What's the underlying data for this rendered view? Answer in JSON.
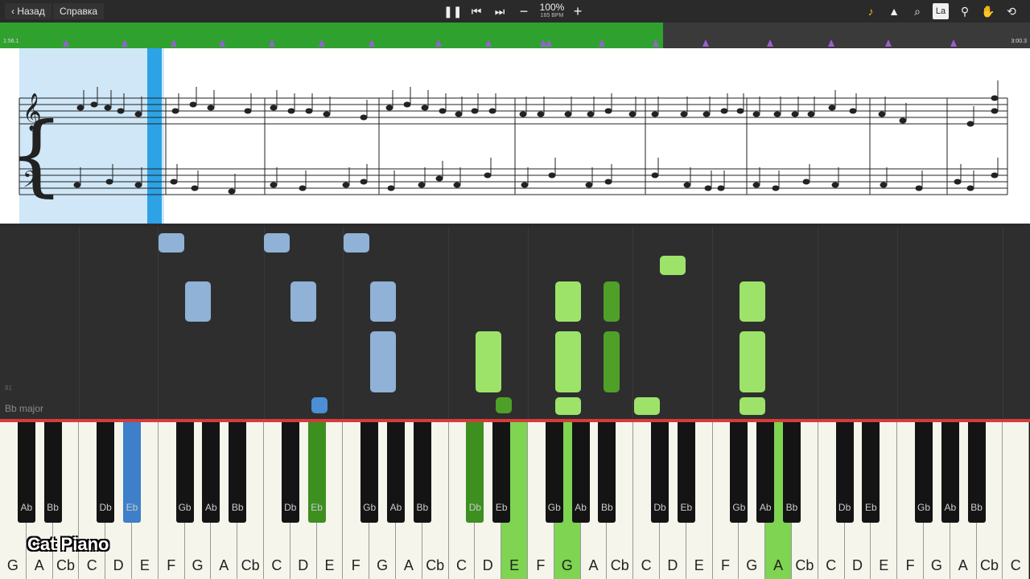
{
  "toolbar": {
    "back_label": "Назад",
    "help_label": "Справка",
    "tempo_percent": "100%",
    "tempo_bpm": "165 BPM",
    "label_button": "La"
  },
  "timeline": {
    "start_time": "1:56.1",
    "end_time": "3:00.3",
    "progress": 0.644
  },
  "roll": {
    "key_signature": "Bb major",
    "bar_number": "81"
  },
  "keyboard": {
    "white_keys": [
      "G",
      "A",
      "Cb",
      "C",
      "D",
      "E",
      "F",
      "G",
      "A",
      "Cb",
      "C",
      "D",
      "E",
      "F",
      "G",
      "A",
      "Cb",
      "C",
      "D",
      "E",
      "F",
      "G",
      "A",
      "Cb",
      "C",
      "D",
      "E",
      "F",
      "G",
      "A",
      "Cb",
      "C",
      "D",
      "E",
      "F",
      "G",
      "A",
      "Cb",
      "C"
    ],
    "black_keys": [
      "Ab",
      "Bb",
      "Db",
      "Eb",
      "Gb",
      "Ab",
      "Bb",
      "Db",
      "Eb",
      "Gb",
      "Ab",
      "Bb",
      "Db",
      "Eb",
      "Gb",
      "Ab",
      "Bb",
      "Db",
      "Eb",
      "Gb",
      "Ab",
      "Bb",
      "Db",
      "Eb",
      "Gb",
      "Ab",
      "Bb"
    ]
  },
  "logo": "Cat Piano",
  "colors": {
    "left_hand": "#4b8fd6",
    "right_hand": "#7fd452",
    "progress": "#2fa12f"
  }
}
